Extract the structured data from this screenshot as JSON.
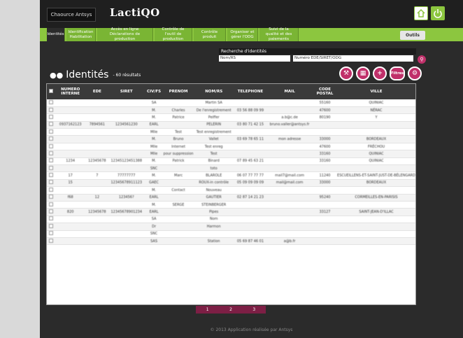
{
  "app": {
    "brand_box": "Chaource Antsys",
    "logo": "LactiQO",
    "home_icon": "home-icon",
    "power_icon": "power-icon"
  },
  "nav": {
    "items": [
      {
        "label": "Identités"
      },
      {
        "label": "Identification Habilitation"
      },
      {
        "label": "Accès en ligne Déclarations de production"
      },
      {
        "label": "Contrôle de l'outil de production"
      },
      {
        "label": "Contrôle produit"
      },
      {
        "label": "Organiser et gérer l'ODG"
      },
      {
        "label": "Suivi de la qualité et des paiements"
      }
    ],
    "outils": "Outils"
  },
  "search": {
    "title": "Recherche d'identités",
    "field1_label": "Nom/RS",
    "field2_label": "Numéro EDE/SIRET/ODG"
  },
  "page": {
    "title": "Identités",
    "count": "- 60 résultats",
    "action_filtres": "Filtres"
  },
  "table": {
    "headers": [
      "NUMERO INTERNE",
      "EDE",
      "SIRET",
      "CIV/FS",
      "PRENOM",
      "NOM/RS",
      "TELEPHONE",
      "MAIL",
      "CODE POSTAL",
      "VILLE"
    ],
    "rows": [
      [
        "",
        "",
        "",
        "SA",
        "",
        "Martin SA",
        "",
        "",
        "55160",
        "QUINIAC"
      ],
      [
        "",
        "",
        "",
        "M.",
        "Charles",
        "De l'enregistrement",
        "03 56 88 09 99",
        "",
        "47600",
        "NÉRAC"
      ],
      [
        "",
        "",
        "",
        "M.",
        "Patrice",
        "Peiffer",
        "",
        "a.b@c.de",
        "80190",
        "Y"
      ],
      [
        "0937162123",
        "7894561",
        "1234561230",
        "EARL",
        "",
        "PELERIN",
        "03 80 71 42 15",
        "bruno.valler@antsys.fr",
        "",
        ""
      ],
      [
        "",
        "",
        "",
        "Mlle",
        "Test",
        "Test enregistrement",
        "",
        "",
        "",
        ""
      ],
      [
        "",
        "",
        "",
        "M.",
        "Bruno",
        "Vallet",
        "03 69 78 65 11",
        "mon adresse",
        "33000",
        "BORDEAUX"
      ],
      [
        "",
        "",
        "",
        "Mlle",
        "Internet",
        "Test enreg",
        "",
        "",
        "47600",
        "FRÉCHOU"
      ],
      [
        "",
        "",
        "",
        "Mlle",
        "pour suppression",
        "Test",
        "",
        "",
        "33160",
        "QUINIAC"
      ],
      [
        "1234",
        "12345678",
        "12345123451388",
        "M.",
        "Patrick",
        "Binard",
        "07 89 45 63 21",
        "",
        "33160",
        "QUINIAC"
      ],
      [
        "",
        "",
        "",
        "SNC",
        "",
        "toto",
        "",
        "",
        "",
        ""
      ],
      [
        "17",
        "7",
        "77777777",
        "M.",
        "Marc",
        "BLAROLE",
        "06 07 77 77 77",
        "mail7@mail.com",
        "11240",
        "ESCUEILLENS-ET-SAINT-JUST-DE-BÉLENGARD"
      ],
      [
        "15",
        "",
        "12345678911123",
        "GAEC",
        "",
        "ROUX-in contrôle",
        "05 09 09 09 09",
        "mail@mail.com",
        "33000",
        "BORDEAUX"
      ],
      [
        "",
        "",
        "",
        "M.",
        "Contact",
        "Nouveau",
        "",
        "",
        "",
        ""
      ],
      [
        "f68",
        "12",
        "123456?",
        "EARL",
        "",
        "GAUTIER",
        "02 87 14 21 23",
        "",
        "95240",
        "CORMEILLES-EN-PARISIS"
      ],
      [
        "",
        "",
        "",
        "M.",
        "SERGE",
        "STEINBERGER",
        "",
        "",
        "",
        ""
      ],
      [
        "820",
        "12345678",
        "12345678901234",
        "EARL",
        "",
        "Pipes",
        "",
        "",
        "33127",
        "SAINT-JEAN-D'ILLAC"
      ],
      [
        "",
        "",
        "",
        "SA",
        "",
        "Nom",
        "",
        "",
        "",
        ""
      ],
      [
        "",
        "",
        "",
        "Dr",
        "",
        "Harmon",
        "",
        "",
        "",
        ""
      ],
      [
        "",
        "",
        "",
        "SNC",
        "",
        "",
        "",
        "",
        "",
        ""
      ],
      [
        "",
        "",
        "",
        "SAS",
        "",
        "Station",
        "05 69 87 46 01",
        "a@b.fr",
        "",
        ""
      ]
    ]
  },
  "pagination": [
    "1",
    "2",
    "3"
  ],
  "footer": "© 2013  Application réalisée par Antsys"
}
